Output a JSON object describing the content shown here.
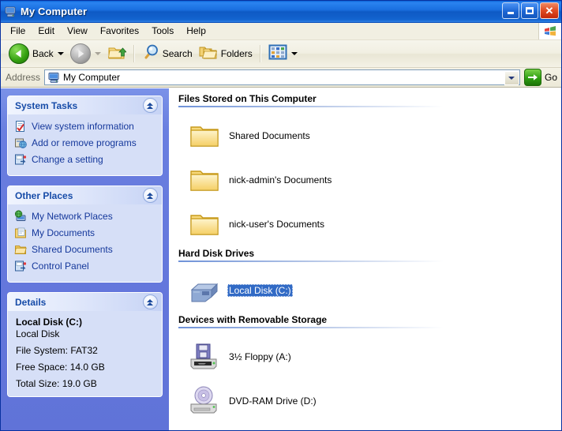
{
  "window": {
    "title": "My Computer",
    "title_icon": "my-computer-icon",
    "buttons": {
      "minimize": "Minimize",
      "maximize": "Maximize",
      "close": "Close"
    }
  },
  "menubar": {
    "items": [
      {
        "label": "File"
      },
      {
        "label": "Edit"
      },
      {
        "label": "View"
      },
      {
        "label": "Favorites"
      },
      {
        "label": "Tools"
      },
      {
        "label": "Help"
      }
    ],
    "brand_icon": "windows-flag-icon"
  },
  "toolbar": {
    "back_label": "Back",
    "back_icon": "back-arrow-icon",
    "forward_icon": "forward-arrow-icon",
    "up_icon": "up-folder-icon",
    "search_label": "Search",
    "search_icon": "magnifier-icon",
    "folders_label": "Folders",
    "folders_icon": "folders-icon",
    "views_icon": "views-grid-icon"
  },
  "address": {
    "label": "Address",
    "value": "My Computer",
    "icon": "my-computer-icon",
    "dropdown_icon": "chevron-down-icon",
    "go_label": "Go",
    "go_icon": "go-arrow-icon"
  },
  "sidebar": {
    "panels": [
      {
        "title": "System Tasks",
        "collapse_icon": "chevron-up-icon",
        "items": [
          {
            "label": "View system information",
            "icon": "system-info-icon"
          },
          {
            "label": "Add or remove programs",
            "icon": "add-remove-programs-icon"
          },
          {
            "label": "Change a setting",
            "icon": "control-panel-icon"
          }
        ]
      },
      {
        "title": "Other Places",
        "collapse_icon": "chevron-up-icon",
        "items": [
          {
            "label": "My Network Places",
            "icon": "network-places-icon"
          },
          {
            "label": "My Documents",
            "icon": "my-documents-icon"
          },
          {
            "label": "Shared Documents",
            "icon": "shared-folder-icon"
          },
          {
            "label": "Control Panel",
            "icon": "control-panel-icon"
          }
        ]
      }
    ],
    "details": {
      "title": "Details",
      "collapse_icon": "chevron-up-icon",
      "name": "Local Disk (C:)",
      "type": "Local Disk",
      "file_system": "File System: FAT32",
      "free_space": "Free Space: 14.0 GB",
      "total_size": "Total Size: 19.0 GB"
    }
  },
  "content": {
    "groups": [
      {
        "heading": "Files Stored on This Computer",
        "items": [
          {
            "label": "Shared Documents",
            "icon": "folder-icon",
            "selected": false
          },
          {
            "label": "nick-admin's Documents",
            "icon": "folder-icon",
            "selected": false
          },
          {
            "label": "nick-user's Documents",
            "icon": "folder-icon",
            "selected": false
          }
        ]
      },
      {
        "heading": "Hard Disk Drives",
        "items": [
          {
            "label": "Local Disk (C:)",
            "icon": "hard-drive-icon",
            "selected": true
          }
        ]
      },
      {
        "heading": "Devices with Removable Storage",
        "items": [
          {
            "label": "3½ Floppy (A:)",
            "icon": "floppy-drive-icon",
            "selected": false
          },
          {
            "label": "DVD-RAM Drive (D:)",
            "icon": "dvd-drive-icon",
            "selected": false
          }
        ]
      }
    ]
  },
  "colors": {
    "title_bar_blue": "#1a6fe0",
    "sidebar_blue": "#6477dc",
    "panel_body": "#d6dff7",
    "panel_title_text": "#174ca8",
    "link_text": "#15389b",
    "selection_blue": "#316ac5",
    "close_red": "#e04a22",
    "menu_bg": "#f1efe2"
  }
}
